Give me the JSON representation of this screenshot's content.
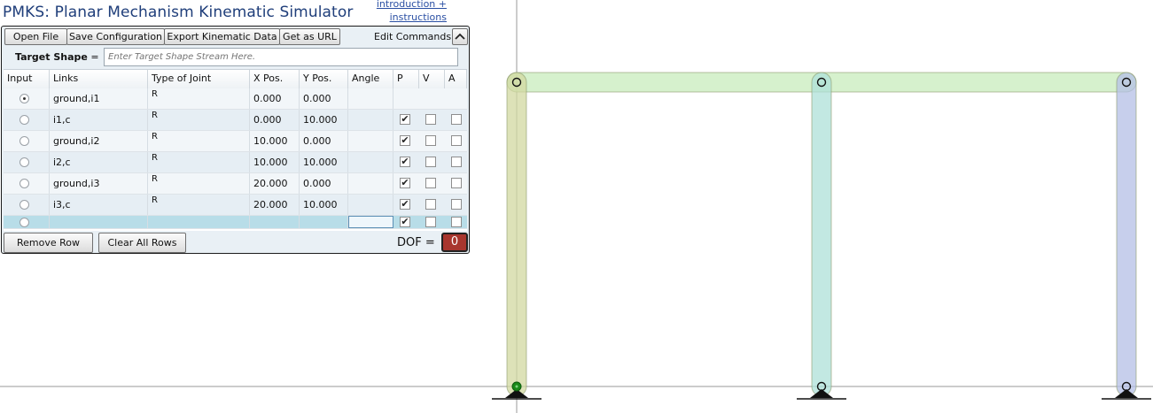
{
  "app": {
    "title": "PMKS: Planar Mechanism Kinematic Simulator",
    "help_link_line1": "introduction +",
    "help_link_line2": "instructions"
  },
  "toolbar": {
    "open_file": "Open File",
    "save_configuration": "Save Configuration",
    "export_kinematic_data": "Export Kinematic Data",
    "get_as_url": "Get as URL",
    "edit_commands": "Edit Commands",
    "collapse_icon": "chevron-up-icon"
  },
  "target_shape": {
    "label": "Target Shape",
    "equals": " =",
    "placeholder": "Enter Target Shape Stream Here.",
    "value": ""
  },
  "table": {
    "headers": {
      "input": "Input",
      "links": "Links",
      "type": "Type of Joint",
      "x": "X Pos.",
      "y": "Y Pos.",
      "angle": "Angle",
      "p": "P",
      "v": "V",
      "a": "A"
    },
    "rows": [
      {
        "input_selected": true,
        "links": "ground,i1",
        "type": "R",
        "x": "0.000",
        "y": "0.000",
        "angle": "",
        "p": null,
        "v": null,
        "a": null
      },
      {
        "input_selected": false,
        "links": "i1,c",
        "type": "R",
        "x": "0.000",
        "y": "10.000",
        "angle": "",
        "p": true,
        "v": false,
        "a": false
      },
      {
        "input_selected": false,
        "links": "ground,i2",
        "type": "R",
        "x": "10.000",
        "y": "0.000",
        "angle": "",
        "p": true,
        "v": false,
        "a": false
      },
      {
        "input_selected": false,
        "links": "i2,c",
        "type": "R",
        "x": "10.000",
        "y": "10.000",
        "angle": "",
        "p": true,
        "v": false,
        "a": false
      },
      {
        "input_selected": false,
        "links": "ground,i3",
        "type": "R",
        "x": "20.000",
        "y": "0.000",
        "angle": "",
        "p": true,
        "v": false,
        "a": false
      },
      {
        "input_selected": false,
        "links": "i3,c",
        "type": "R",
        "x": "20.000",
        "y": "10.000",
        "angle": "",
        "p": true,
        "v": false,
        "a": false
      }
    ],
    "new_row": {
      "input_selected": false,
      "links": "",
      "type": "",
      "x": "",
      "y": "",
      "angle": "",
      "p": true,
      "v": false,
      "a": false
    }
  },
  "footer": {
    "remove_row": "Remove Row",
    "clear_all_rows": "Clear All Rows",
    "dof_label": "DOF =",
    "dof_value": "0"
  },
  "mechanism": {
    "links": [
      {
        "name": "i1",
        "color": "#d2d8a0"
      },
      {
        "name": "i2",
        "color": "#aee0d8"
      },
      {
        "name": "i3",
        "color": "#b4bfe6"
      },
      {
        "name": "c",
        "color": "#c8ecbc"
      }
    ],
    "joints": [
      {
        "links": "ground,i1",
        "x": 0,
        "y": 0,
        "ground": true,
        "input": true
      },
      {
        "links": "i1,c",
        "x": 0,
        "y": 10,
        "ground": false,
        "input": false
      },
      {
        "links": "ground,i2",
        "x": 10,
        "y": 0,
        "ground": true,
        "input": false
      },
      {
        "links": "i2,c",
        "x": 10,
        "y": 10,
        "ground": false,
        "input": false
      },
      {
        "links": "ground,i3",
        "x": 20,
        "y": 0,
        "ground": true,
        "input": false
      },
      {
        "links": "i3,c",
        "x": 20,
        "y": 10,
        "ground": false,
        "input": false
      }
    ],
    "input_joint_color": "#1a8a1a",
    "axis_color": "#9a9a9a"
  },
  "theme": {
    "title_color": "#1f3e7a",
    "dof_color": "#a8362e"
  }
}
